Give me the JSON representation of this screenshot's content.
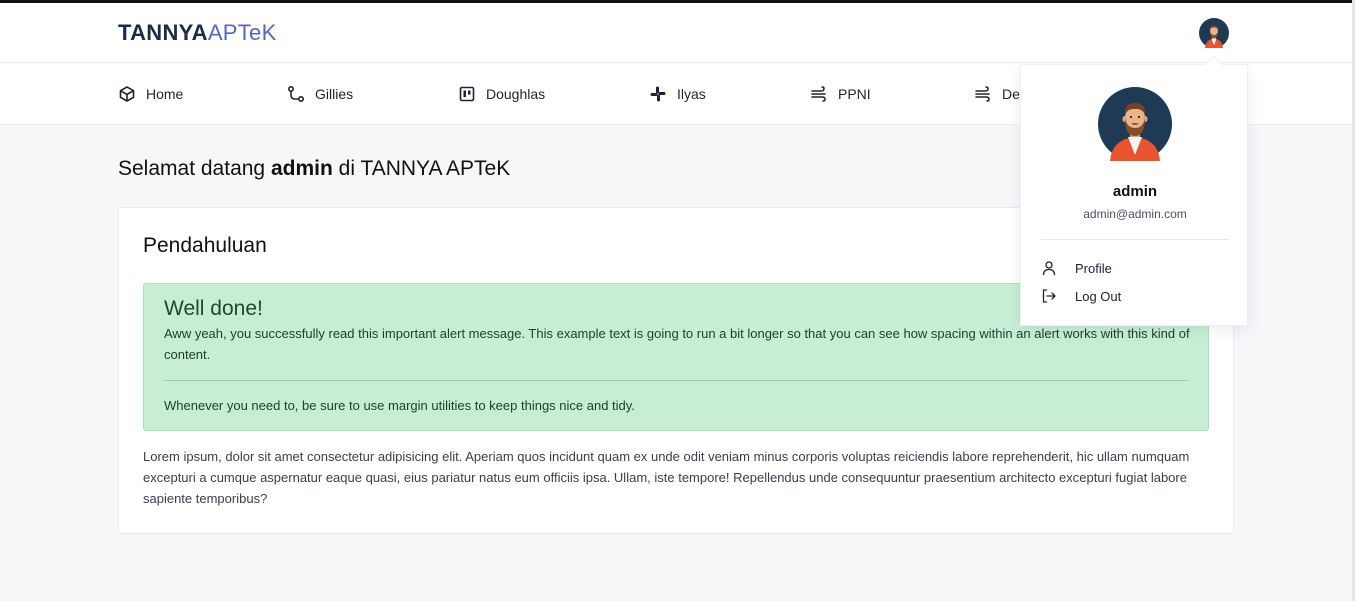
{
  "brand": {
    "part1": "TANNYA",
    "part2": "APTeK"
  },
  "nav": [
    {
      "label": "Home",
      "icon": "cube-icon"
    },
    {
      "label": "Gillies",
      "icon": "route-icon"
    },
    {
      "label": "Doughlas",
      "icon": "board-icon"
    },
    {
      "label": "Ilyas",
      "icon": "slack-icon"
    },
    {
      "label": "PPNI",
      "icon": "wind-icon"
    },
    {
      "label": "De",
      "icon": "wind-icon"
    }
  ],
  "welcome": {
    "prefix": "Selamat datang",
    "user": "admin",
    "suffix": "di TANNYA APTeK"
  },
  "card": {
    "title": "Pendahuluan",
    "alert": {
      "heading": "Well done!",
      "text": "Aww yeah, you successfully read this important alert message. This example text is going to run a bit longer so that you can see how spacing within an alert works with this kind of content.",
      "footer": "Whenever you need to, be sure to use margin utilities to keep things nice and tidy."
    },
    "body": "Lorem ipsum, dolor sit amet consectetur adipisicing elit. Aperiam quos incidunt quam ex unde odit veniam minus corporis voluptas reiciendis labore reprehenderit, hic ullam numquam excepturi a cumque aspernatur eaque quasi, eius pariatur natus eum officiis ipsa. Ullam, iste tempore! Repellendus unde consequuntur praesentium architecto excepturi fugiat labore sapiente temporibus?"
  },
  "user_menu": {
    "name": "admin",
    "email": "admin@admin.com",
    "items": [
      {
        "label": "Profile",
        "icon": "user-icon"
      },
      {
        "label": "Log Out",
        "icon": "logout-icon"
      }
    ]
  },
  "colors": {
    "brand_dark": "#1e2a4a",
    "brand_accent": "#5b63c9",
    "alert_bg": "#c7eed5",
    "avatar_bg": "#1e3a55"
  }
}
